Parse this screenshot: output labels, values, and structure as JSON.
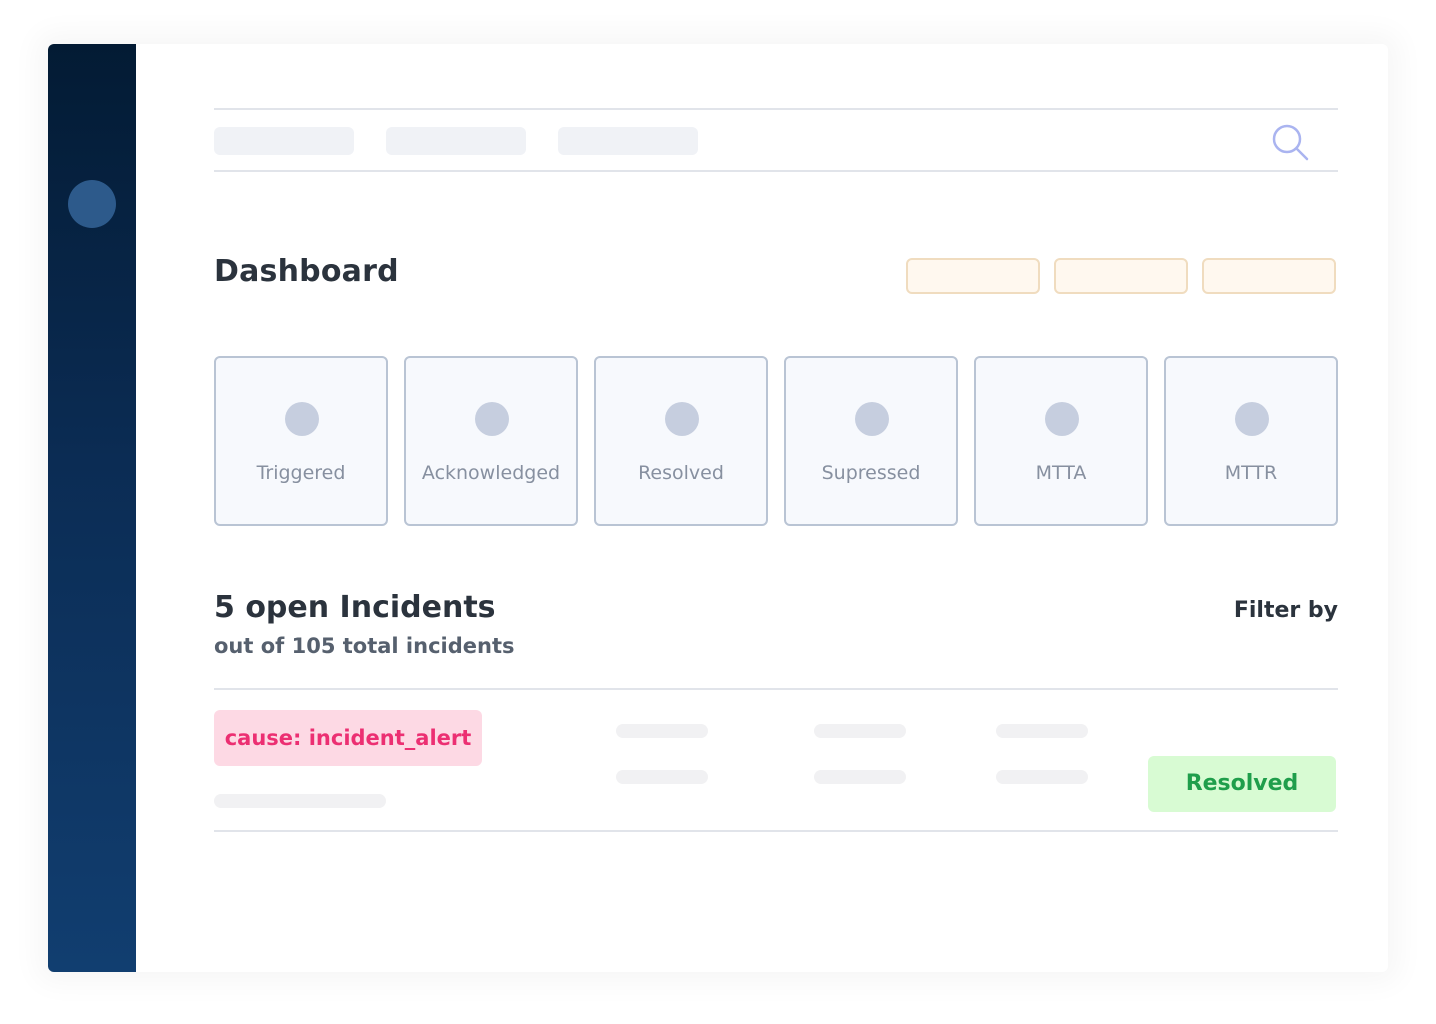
{
  "app": {
    "sidebar": {
      "avatar_icon": "avatar"
    },
    "topbar": {
      "nav_placeholders": 3,
      "search_icon": "search-icon"
    }
  },
  "dashboard": {
    "title": "Dashboard",
    "action_buttons": 3,
    "stats": [
      {
        "label": "Triggered"
      },
      {
        "label": "Acknowledged"
      },
      {
        "label": "Resolved"
      },
      {
        "label": "Supressed"
      },
      {
        "label": "MTTA"
      },
      {
        "label": "MTTR"
      }
    ]
  },
  "incidents": {
    "title": "5 open Incidents",
    "subtitle": "out of 105 total incidents",
    "filter_label": "Filter by",
    "row": {
      "cause": "cause: incident_alert",
      "status": "Resolved"
    }
  },
  "colors": {
    "sidebar_top": "#031b34",
    "sidebar_bottom": "#113e70",
    "cause_text": "#ec2f72",
    "cause_bg": "#fdd9e4",
    "status_text": "#1f9e4b",
    "status_bg": "#d8fbd3",
    "search_icon": "#aab4f0"
  }
}
